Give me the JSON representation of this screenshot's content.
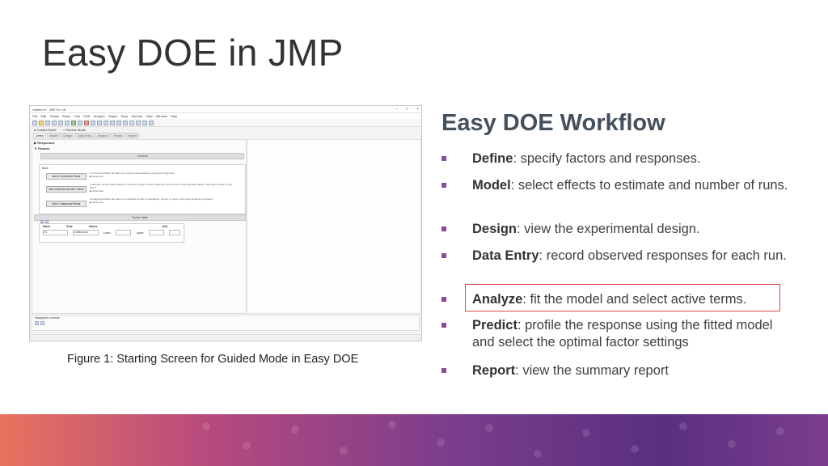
{
  "slide": {
    "title": "Easy DOE in JMP",
    "caption": "Figure 1: Starting Screen for Guided Mode in Easy DOE"
  },
  "jmp_window": {
    "title": "Untitled 6 - JMP Pro 18",
    "menu": [
      "File",
      "Edit",
      "Tables",
      "Rows",
      "Cols",
      "DOE",
      "Analyze",
      "Graph",
      "Tools",
      "Add-Ins",
      "View",
      "Window",
      "Help"
    ],
    "modes": {
      "guided": "Guided Mode",
      "flexible": "Flexible Mode"
    },
    "tabs": [
      "Define",
      "Model",
      "Design",
      "Data Entry",
      "Analyze",
      "Predict",
      "Report"
    ],
    "responses_label": "Responses",
    "factors_label": "Factors",
    "choices_label": "Choices",
    "base_label": "Base",
    "add_buttons": [
      {
        "label": "Add a Continuous Factor",
        "desc": "A continuous factor can take any numeric value between a low and a high level.",
        "hint": "Show Hint"
      },
      {
        "label": "Add a Discrete Numeric Factor",
        "desc": "A discrete numeric factor takes on a low and a high numeric value but it can be set to user-specified values. How many levels do you have?",
        "hint": "Show Hint"
      },
      {
        "label": "Add a Categorical Factor",
        "desc": "A categorical factor can take on a specified number of categories, groups, or types. How many levels do you have?",
        "hint": "Show Hint"
      }
    ],
    "factor_table": {
      "title": "Factor Table",
      "headers": [
        "Name",
        "Role",
        "Values",
        "Unit"
      ],
      "row": {
        "name": "X1",
        "role": "Continuous",
        "lower": "Lower",
        "upper": "Upper"
      }
    },
    "navigation_label": "Navigation controls"
  },
  "workflow": {
    "title": "Easy DOE Workflow",
    "items": [
      {
        "term": "Define",
        "text": ": specify factors and responses."
      },
      {
        "term": "Model",
        "text": ": select effects to estimate and number of runs."
      },
      {
        "term": "Design",
        "text": ": view the experimental design."
      },
      {
        "term": "Data Entry",
        "text": ": record observed responses for each run."
      },
      {
        "term": "Analyze",
        "text": ": fit the model and select active terms."
      },
      {
        "term": "Predict",
        "text": ": profile the response using the fitted model and select the optimal factor settings"
      },
      {
        "term": "Report",
        "text": ": view the summary report"
      }
    ]
  },
  "colors": {
    "bullet": "#8c4a9f",
    "highlight_box": "#d94848",
    "footer_start": "#e8735e",
    "footer_end": "#5a2f80"
  }
}
